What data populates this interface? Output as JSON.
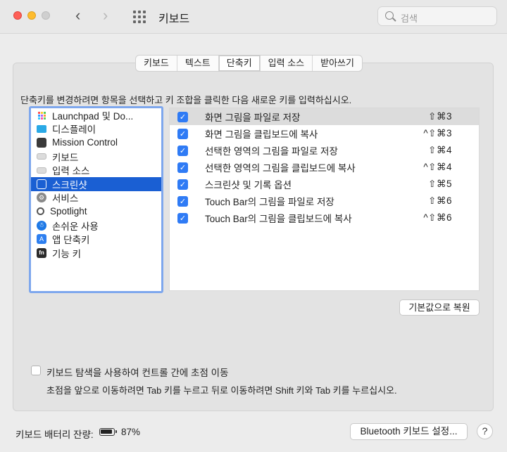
{
  "window": {
    "title": "키보드",
    "search_placeholder": "검색"
  },
  "tabs": [
    {
      "label": "키보드",
      "active": false
    },
    {
      "label": "텍스트",
      "active": false
    },
    {
      "label": "단축키",
      "active": true
    },
    {
      "label": "입력 소스",
      "active": false
    },
    {
      "label": "받아쓰기",
      "active": false
    }
  ],
  "instruction": "단축키를 변경하려면 항목을 선택하고 키 조합을 클릭한 다음 새로운 키를 입력하십시오.",
  "sidebar": {
    "items": [
      {
        "label": "Launchpad 및 Do...",
        "icon": "launchpad-icon",
        "selected": false
      },
      {
        "label": "디스플레이",
        "icon": "display-icon",
        "selected": false
      },
      {
        "label": "Mission Control",
        "icon": "mission-control-icon",
        "selected": false
      },
      {
        "label": "키보드",
        "icon": "keyboard-icon",
        "selected": false
      },
      {
        "label": "입력 소스",
        "icon": "input-source-icon",
        "selected": false
      },
      {
        "label": "스크린샷",
        "icon": "screenshot-icon",
        "selected": true
      },
      {
        "label": "서비스",
        "icon": "services-icon",
        "selected": false
      },
      {
        "label": "Spotlight",
        "icon": "spotlight-icon",
        "selected": false
      },
      {
        "label": "손쉬운 사용",
        "icon": "accessibility-icon",
        "selected": false
      },
      {
        "label": "앱 단축키",
        "icon": "app-shortcuts-icon",
        "selected": false
      },
      {
        "label": "기능 키",
        "icon": "fn-key-icon",
        "selected": false
      }
    ]
  },
  "shortcuts": [
    {
      "label": "화면 그림을 파일로 저장",
      "keys": "⇧⌘3",
      "checked": true
    },
    {
      "label": "화면 그림을 클립보드에 복사",
      "keys": "^⇧⌘3",
      "checked": true
    },
    {
      "label": "선택한 영역의 그림을 파일로 저장",
      "keys": "⇧⌘4",
      "checked": true
    },
    {
      "label": "선택한 영역의 그림을 클립보드에 복사",
      "keys": "^⇧⌘4",
      "checked": true
    },
    {
      "label": "스크린샷 및 기록 옵션",
      "keys": "⇧⌘5",
      "checked": true
    },
    {
      "label": "Touch Bar의 그림을 파일로 저장",
      "keys": "⇧⌘6",
      "checked": true
    },
    {
      "label": "Touch Bar의 그림을 클립보드에 복사",
      "keys": "^⇧⌘6",
      "checked": true
    }
  ],
  "restore_button": "기본값으로 복원",
  "keyboard_nav": {
    "checked": false,
    "label": "키보드 탐색을 사용하여 컨트롤 간에 초점 이동",
    "description": "초점을 앞으로 이동하려면 Tab 키를 누르고 뒤로 이동하려면 Shift 키와 Tab 키를 누르십시오."
  },
  "battery": {
    "label": "키보드 배터리 잔량:",
    "percent": "87%",
    "level": 0.87
  },
  "bluetooth_button": "Bluetooth 키보드 설정...",
  "help_button": "?",
  "colors": {
    "accent": "#2f7bf5",
    "selection": "#1a5fd3"
  }
}
